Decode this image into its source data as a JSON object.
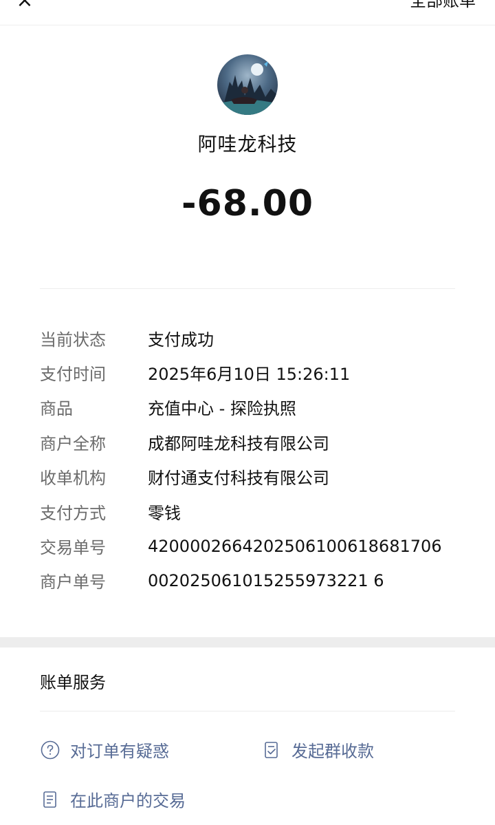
{
  "header": {
    "close_icon": "×",
    "all_bills_label": "全部账单"
  },
  "merchant": {
    "avatar": "merchant-avatar",
    "name": "阿哇龙科技"
  },
  "amount": "-68.00",
  "details": [
    {
      "label": "当前状态",
      "value": "支付成功"
    },
    {
      "label": "支付时间",
      "value": "2025年6月10日 15:26:11"
    },
    {
      "label": "商品",
      "value": "充值中心 - 探险执照"
    },
    {
      "label": "商户全称",
      "value": "成都阿哇龙科技有限公司"
    },
    {
      "label": "收单机构",
      "value": "财付通支付科技有限公司"
    },
    {
      "label": "支付方式",
      "value": "零钱"
    },
    {
      "label": "交易单号",
      "value": "4200002664202506100618681706"
    },
    {
      "label": "商户单号",
      "value": "002025061015255973221 6"
    }
  ],
  "services": {
    "title": "账单服务",
    "items": [
      {
        "label": "对订单有疑惑",
        "icon": "question-circle-icon"
      },
      {
        "label": "发起群收款",
        "icon": "group-collect-icon"
      },
      {
        "label": "在此商户的交易",
        "icon": "document-list-icon"
      }
    ]
  },
  "colors": {
    "link": "#576b95",
    "label_gray": "#6b6b6b",
    "section_gap": "#ededed"
  }
}
